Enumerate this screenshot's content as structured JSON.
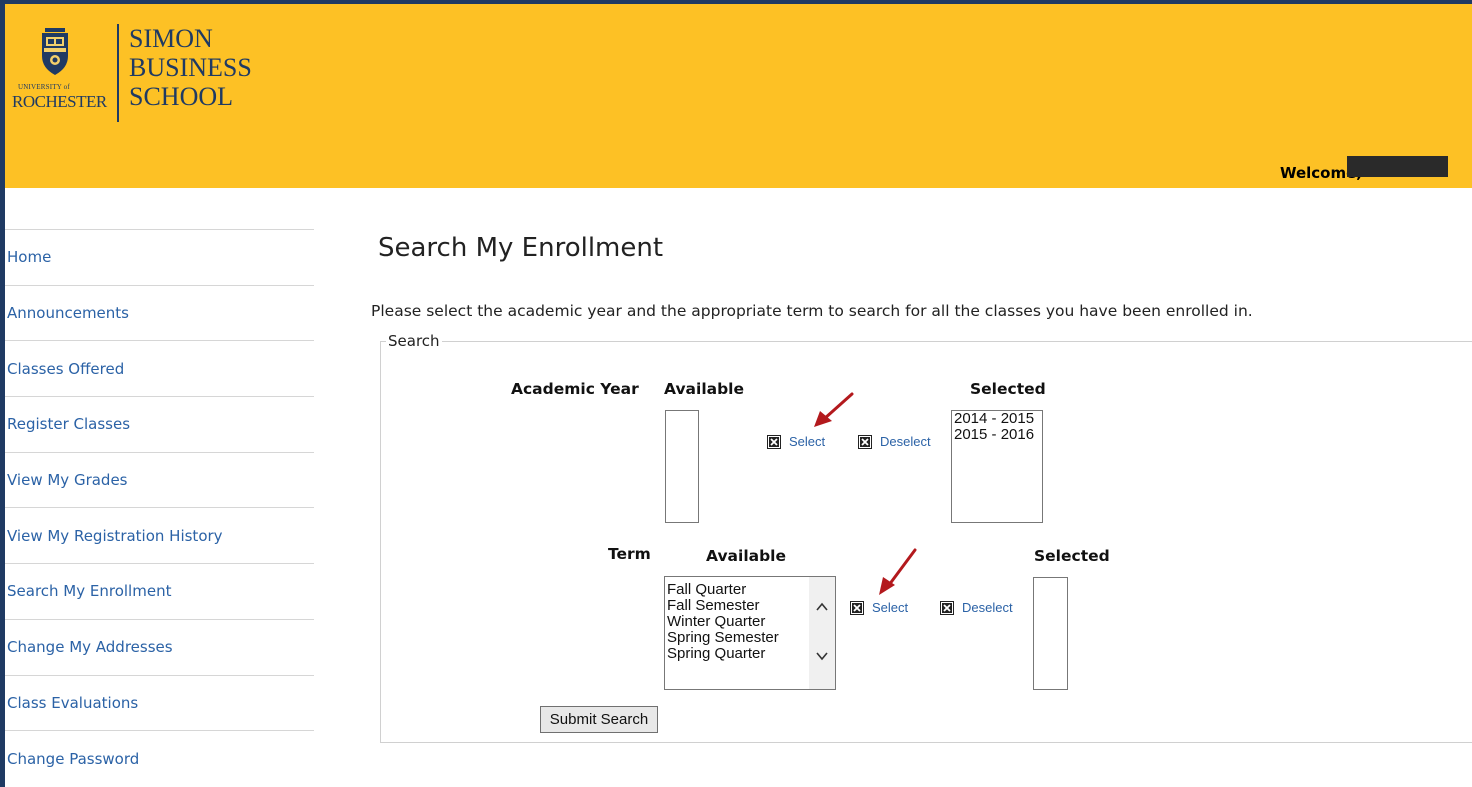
{
  "header": {
    "logo": {
      "university_top": "UNIVERSITY of",
      "university_name": "ROCHESTER",
      "school_lines": [
        "SIMON",
        "BUSINESS",
        "SCHOOL"
      ]
    },
    "welcome_label": "Welcome,",
    "colors": {
      "brand_gold": "#fdc125",
      "brand_navy": "#1f3a63"
    }
  },
  "sidebar": {
    "items": [
      {
        "label": "Home"
      },
      {
        "label": "Announcements"
      },
      {
        "label": "Classes Offered"
      },
      {
        "label": "Register Classes"
      },
      {
        "label": "View My Grades"
      },
      {
        "label": "View My Registration History"
      },
      {
        "label": "Search My Enrollment"
      },
      {
        "label": "Change My Addresses"
      },
      {
        "label": "Class Evaluations"
      },
      {
        "label": "Change Password"
      }
    ]
  },
  "main": {
    "title": "Search My Enrollment",
    "instructions": "Please select the academic year and the appropriate term to search for all the classes you have been enrolled in.",
    "search_legend": "Search",
    "academic_year": {
      "label": "Academic Year",
      "available_label": "Available",
      "selected_label": "Selected",
      "available_options": [],
      "selected_options": [
        "2014 - 2015",
        "2015 - 2016"
      ],
      "select_label": "Select",
      "deselect_label": "Deselect"
    },
    "term": {
      "label": "Term",
      "available_label": "Available",
      "selected_label": "Selected",
      "available_options": [
        "Fall Quarter",
        "Fall Semester",
        "Winter Quarter",
        "Spring Semester",
        "Spring Quarter"
      ],
      "selected_options": [],
      "select_label": "Select",
      "deselect_label": "Deselect"
    },
    "submit_label": "Submit Search"
  }
}
